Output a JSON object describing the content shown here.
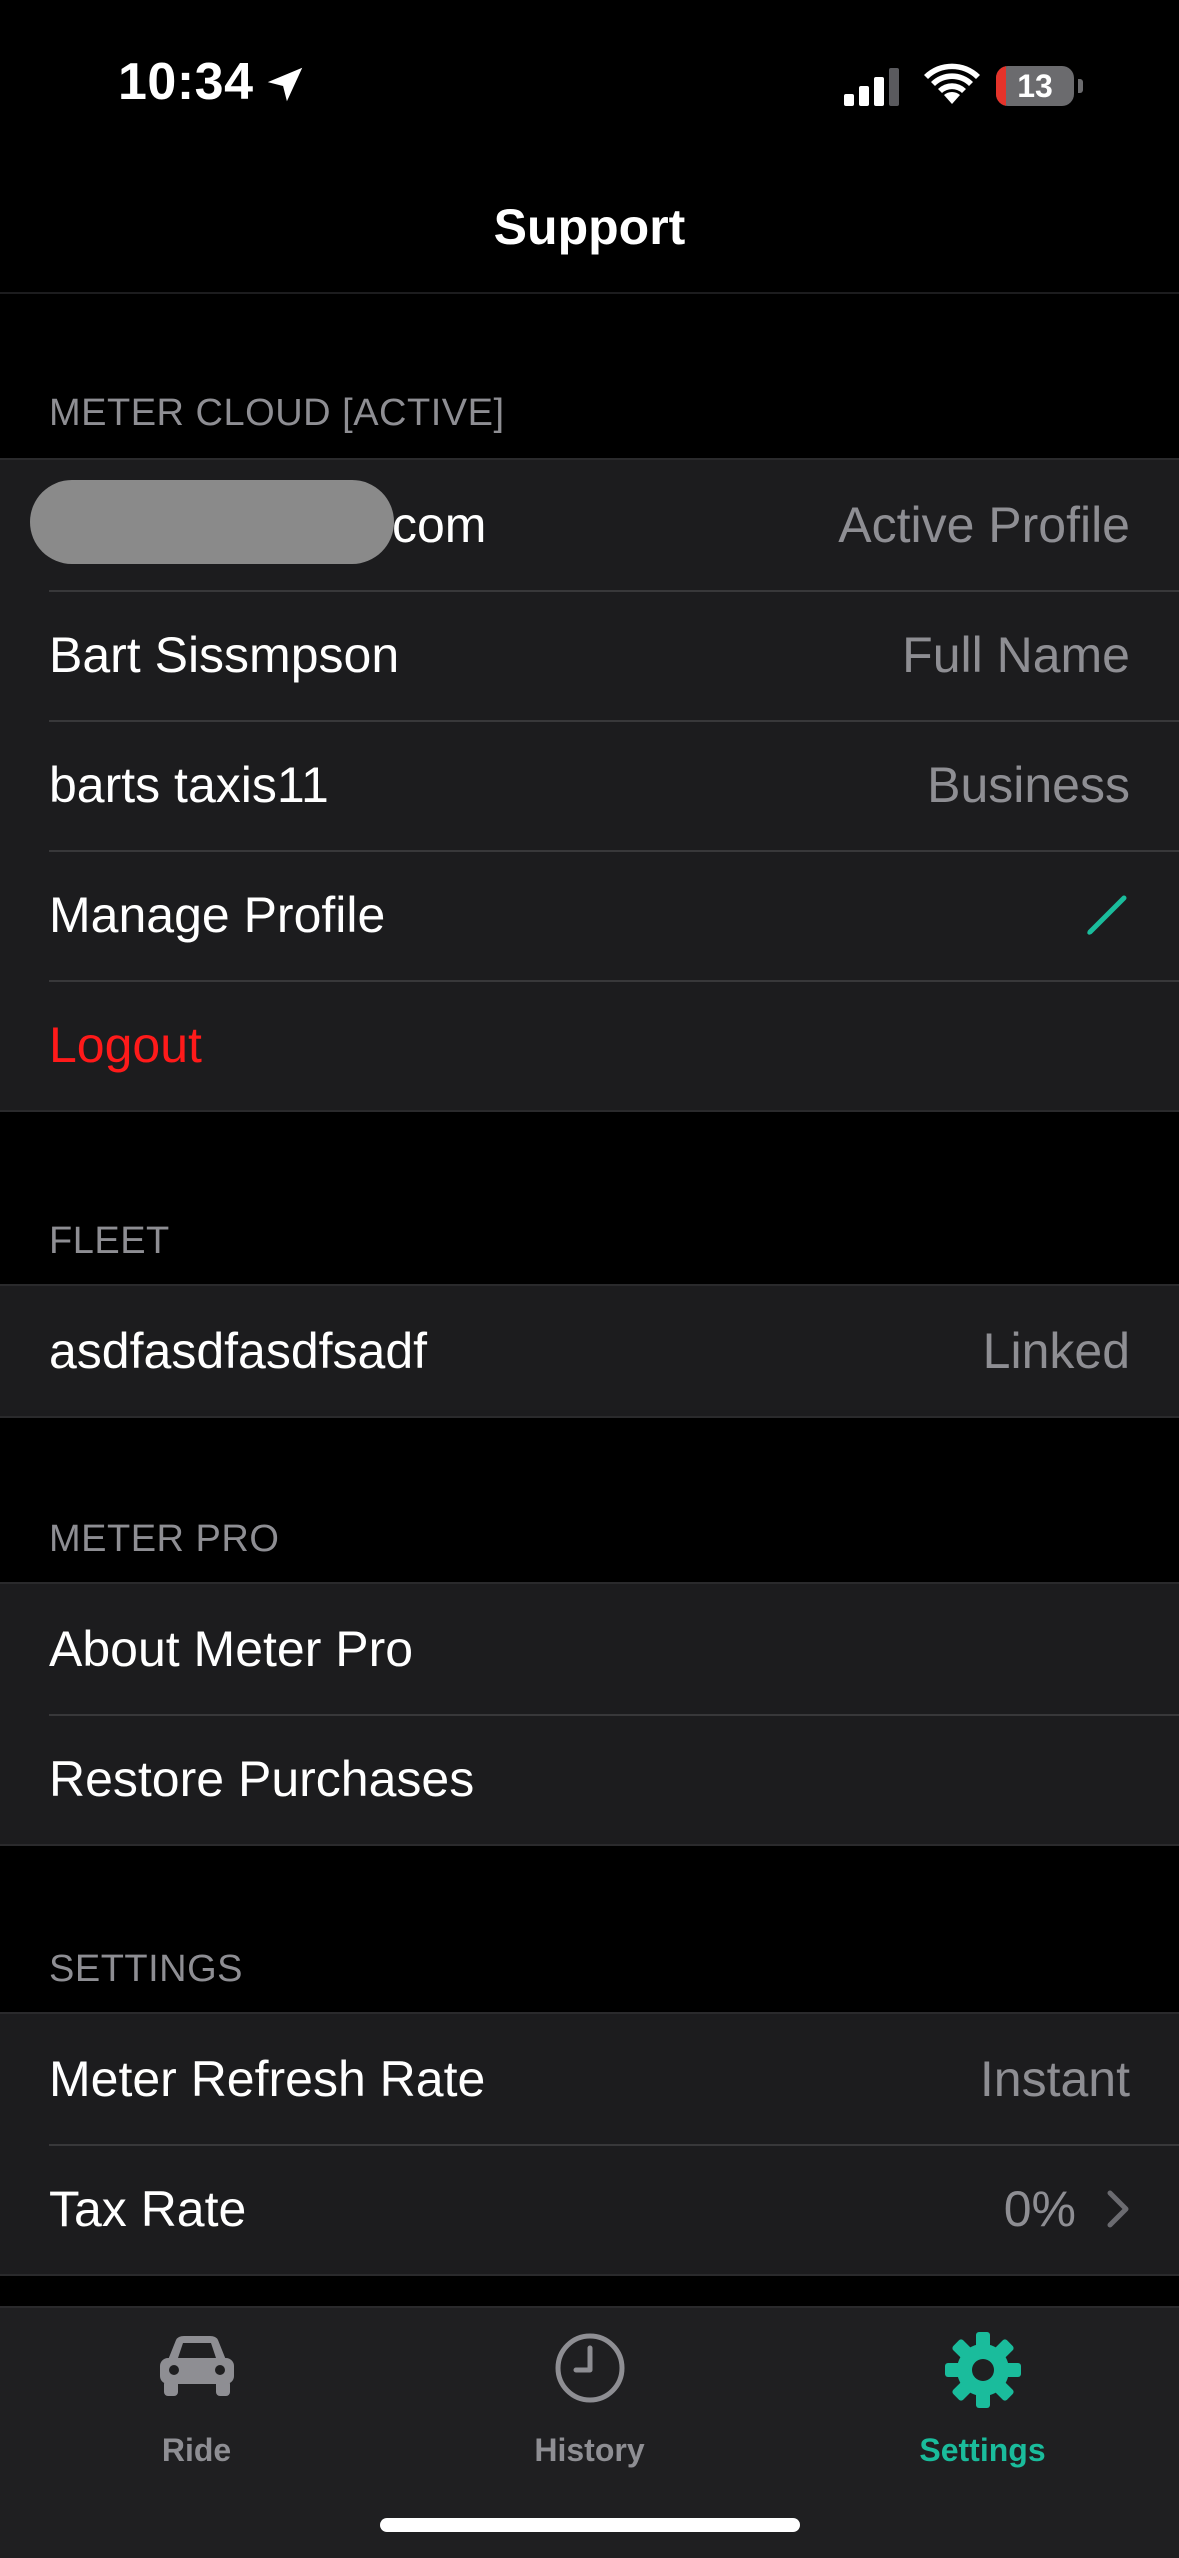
{
  "status_bar": {
    "time": "10:34",
    "battery_level": "13",
    "battery_fraction": 0.13
  },
  "nav": {
    "title": "Support"
  },
  "sections": {
    "meter_cloud": {
      "header": "METER CLOUD [ACTIVE]",
      "email_suffix": "com",
      "email_value": "Active Profile",
      "full_name": "Bart Sissmpson",
      "full_name_value": "Full Name",
      "business": "barts taxis11",
      "business_value": "Business",
      "manage_profile": "Manage Profile",
      "logout": "Logout"
    },
    "fleet": {
      "header": "FLEET",
      "name": "asdfasdfasdfsadf",
      "status": "Linked"
    },
    "meter_pro": {
      "header": "METER PRO",
      "about": "About Meter Pro",
      "restore": "Restore Purchases"
    },
    "settings": {
      "header": "SETTINGS",
      "refresh_rate_label": "Meter Refresh Rate",
      "refresh_rate_value": "Instant",
      "tax_rate_label": "Tax Rate",
      "tax_rate_value": "0%"
    }
  },
  "tabs": [
    {
      "label": "Ride",
      "icon": "car-icon"
    },
    {
      "label": "History",
      "icon": "clock-icon"
    },
    {
      "label": "Settings",
      "icon": "gear-icon"
    }
  ],
  "colors": {
    "accent": "#1abc9c",
    "destructive": "#ff1a1a",
    "background": "#000000",
    "cell": "#1c1c1e",
    "secondary_text": "#8e8e93"
  }
}
